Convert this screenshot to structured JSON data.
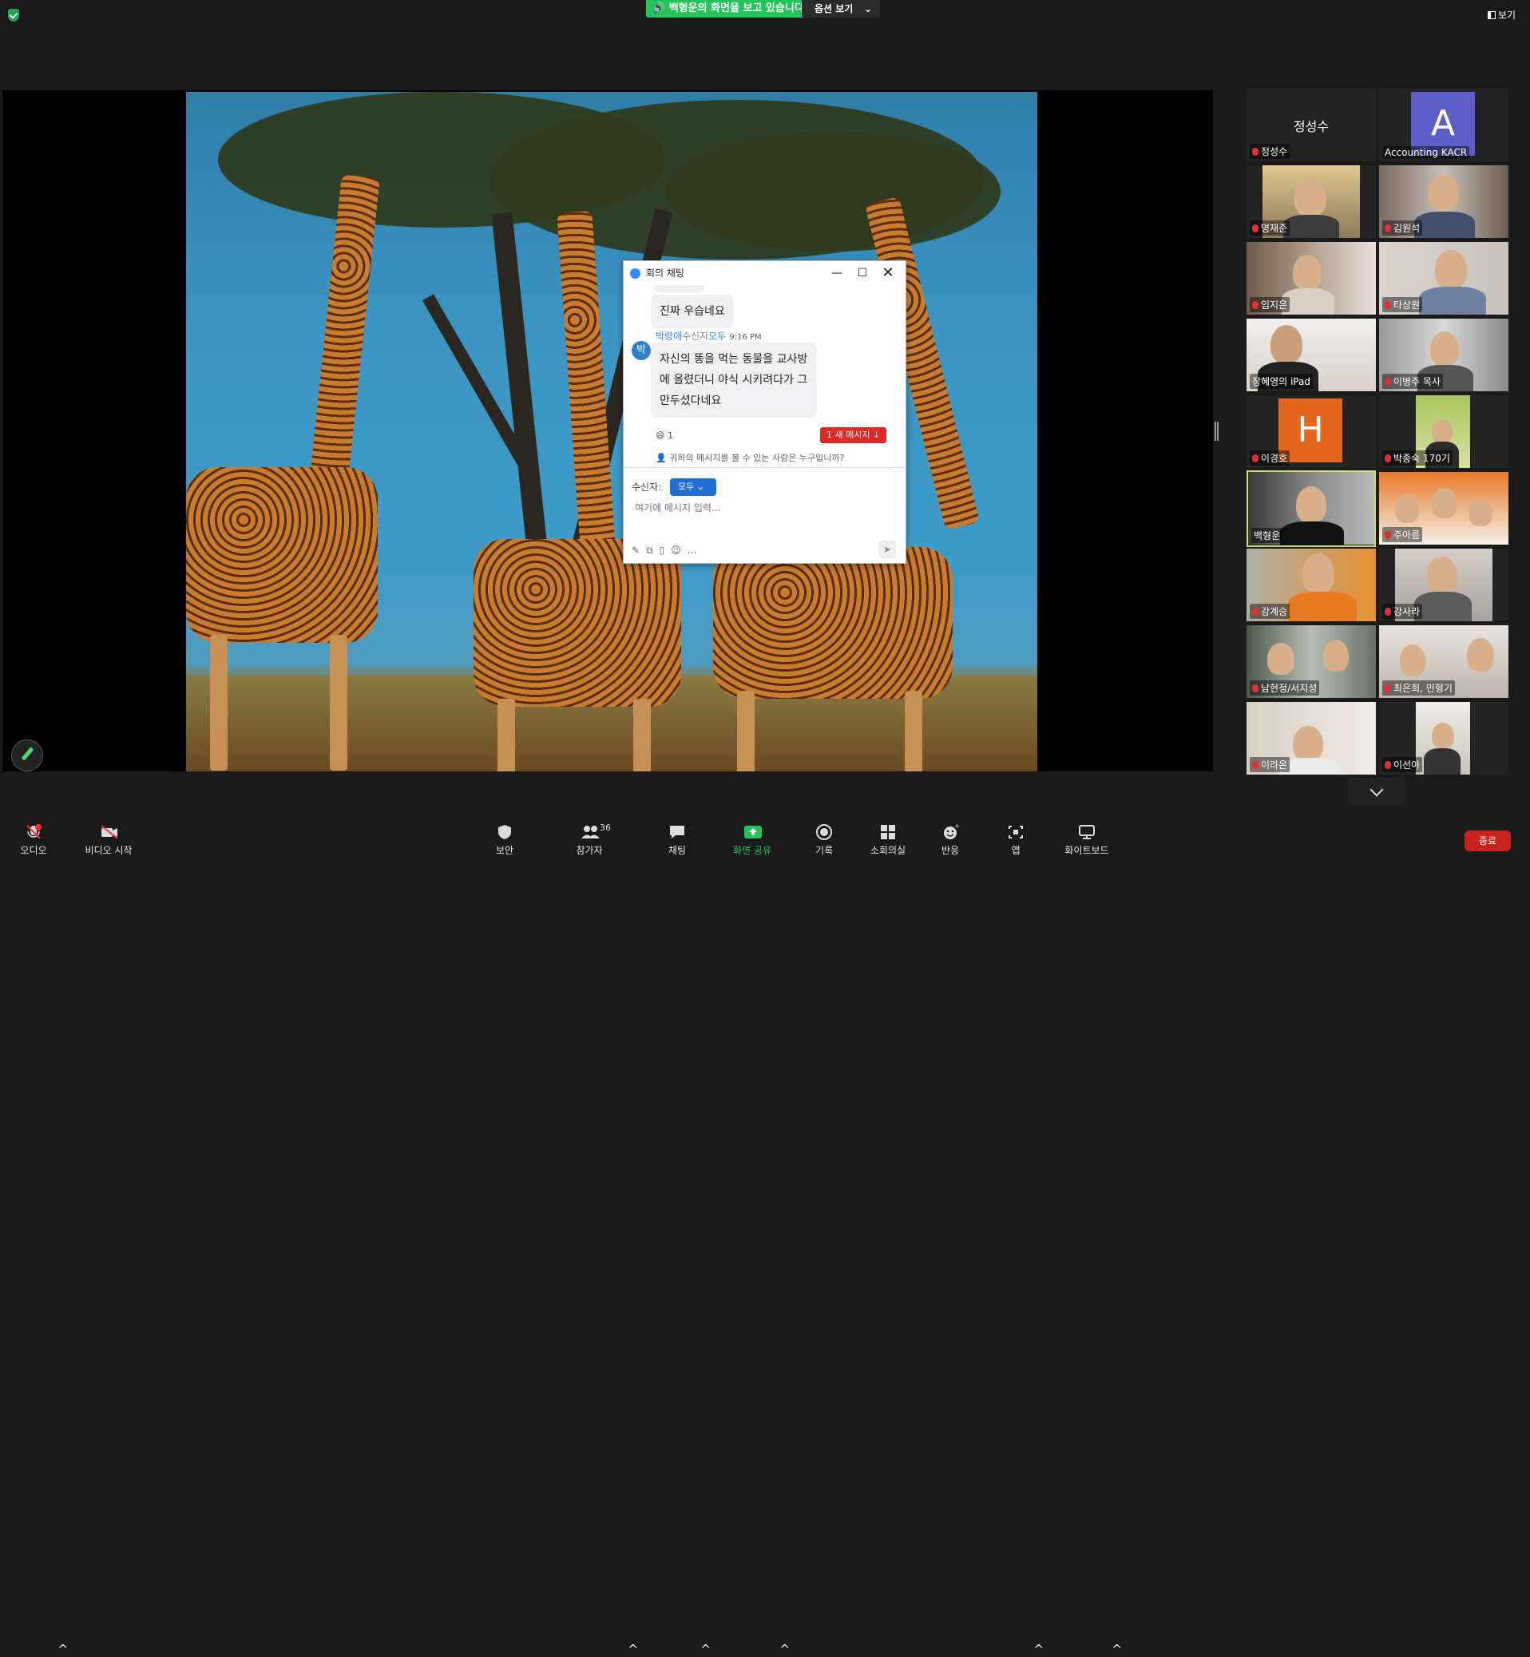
{
  "top": {
    "share_status": "백형운의 화면을 보고 있습니다",
    "view_options": "옵션 보기",
    "view_label": "보기"
  },
  "chat": {
    "title": "회의 채팅",
    "msg1": "진짜 우습네요",
    "sender_name": "박령애",
    "sender_to_label": "수신자",
    "sender_to": "모두",
    "time": "9:16 PM",
    "avatar_initial": "박",
    "msg2": "자신의 똥을 먹는 동물을 교사방에 올렸더니 야식 시키려다가 그만두셨다네요",
    "reaction_count": "1",
    "new_messages": "1 새 메시지",
    "who_can_see": "귀하의 메시지를 볼 수 있는 사람은 누구입니까?",
    "to_label": "수신자:",
    "to_value": "모두",
    "placeholder": "여기에 메시지 입력..."
  },
  "gallery": [
    {
      "name": "정성수",
      "center": "정성수"
    },
    {
      "name": "Accounting KACR",
      "avatar": "A",
      "color": "#5b5fc7"
    },
    {
      "name": "명재준"
    },
    {
      "name": "김원석"
    },
    {
      "name": "임지은"
    },
    {
      "name": "타상원"
    },
    {
      "name": "장혜영의 iPad"
    },
    {
      "name": "이병주 목사"
    },
    {
      "name": "이경호",
      "avatar": "H",
      "color": "#e5661c"
    },
    {
      "name": "박종숙 170기"
    },
    {
      "name": "백형운"
    },
    {
      "name": "주아름"
    },
    {
      "name": "강계승"
    },
    {
      "name": "강사라"
    },
    {
      "name": "남현정/서지성"
    },
    {
      "name": "최은희, 민형기"
    },
    {
      "name": "이라온"
    },
    {
      "name": "이선아"
    }
  ],
  "toolbar": {
    "audio": "오디오",
    "video": "비디오 시작",
    "security": "보안",
    "participants": "참가자",
    "participants_count": "36",
    "chat": "채팅",
    "share": "화면 공유",
    "record": "기록",
    "breakout": "소회의실",
    "reactions": "반응",
    "apps": "앱",
    "whiteboard": "화이트보드",
    "end": "종료"
  }
}
